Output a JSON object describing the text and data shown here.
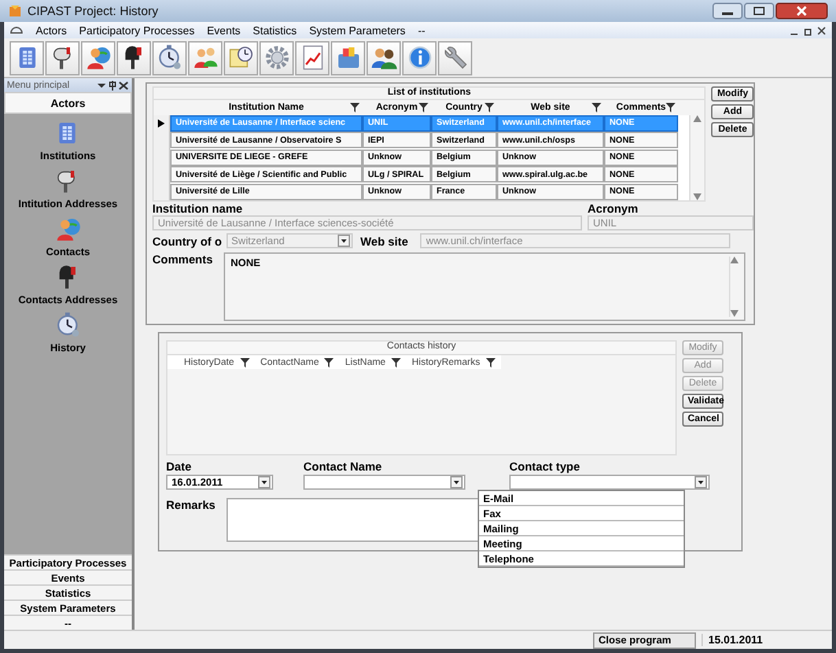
{
  "window": {
    "title": "CIPAST Project: History"
  },
  "menu": [
    "Actors",
    "Participatory Processes",
    "Events",
    "Statistics",
    "System Parameters",
    "--"
  ],
  "sidebar": {
    "title": "Menu principal",
    "section": "Actors",
    "items": [
      {
        "label": "Institutions"
      },
      {
        "label": "Intitution Addresses"
      },
      {
        "label": "Contacts"
      },
      {
        "label": "Contacts Addresses"
      },
      {
        "label": "History"
      }
    ],
    "bottom_sections": [
      "Participatory Processes",
      "Events",
      "Statistics",
      "System Parameters",
      "--"
    ]
  },
  "institutions": {
    "title": "List of institutions",
    "columns": [
      "Institution Name",
      "Acronym",
      "Country",
      "Web site",
      "Comments"
    ],
    "rows": [
      {
        "selected": true,
        "cells": [
          "Université de Lausanne / Interface scienc",
          "UNIL",
          "Switzerland",
          "www.unil.ch/interface",
          "NONE"
        ]
      },
      {
        "selected": false,
        "cells": [
          "Université de Lausanne / Observatoire S",
          "IEPI",
          "Switzerland",
          "www.unil.ch/osps",
          "NONE"
        ]
      },
      {
        "selected": false,
        "cells": [
          "UNIVERSITE DE LIEGE - GREFE",
          "Unknow",
          "Belgium",
          "Unknow",
          "NONE"
        ]
      },
      {
        "selected": false,
        "cells": [
          "Université de Liège / Scientific and Public",
          "ULg / SPIRAL",
          "Belgium",
          "www.spiral.ulg.ac.be",
          "NONE"
        ]
      },
      {
        "selected": false,
        "cells": [
          "Université de Lille",
          "Unknow",
          "France",
          "Unknow",
          "NONE"
        ]
      }
    ],
    "buttons": [
      "Modify",
      "Add",
      "Delete"
    ]
  },
  "form": {
    "institution_name": {
      "label": "Institution name",
      "value": "Université de Lausanne / Interface sciences-société"
    },
    "acronym": {
      "label": "Acronym",
      "value": "UNIL"
    },
    "country": {
      "label": "Country of o",
      "value": "Switzerland"
    },
    "website": {
      "label": "Web site",
      "value": "www.unil.ch/interface"
    },
    "comments": {
      "label": "Comments",
      "value": "NONE"
    }
  },
  "contacts_history": {
    "title": "Contacts history",
    "columns": [
      "HistoryDate",
      "ContactName",
      "ListName",
      "HistoryRemarks"
    ],
    "buttons": [
      {
        "label": "Modify",
        "disabled": true
      },
      {
        "label": "Add",
        "disabled": true
      },
      {
        "label": "Delete",
        "disabled": true
      },
      {
        "label": "Validate",
        "disabled": false
      },
      {
        "label": "Cancel",
        "disabled": false
      }
    ],
    "date": {
      "label": "Date",
      "value": "16.01.2011"
    },
    "contact_name": {
      "label": "Contact Name"
    },
    "contact_type": {
      "label": "Contact type",
      "expanded": true,
      "options": [
        "E-Mail",
        "Fax",
        "Mailing",
        "Meeting",
        "Telephone"
      ]
    },
    "remarks": {
      "label": "Remarks"
    }
  },
  "status_bar": {
    "button": "Close program",
    "date": "15.01.2011"
  }
}
